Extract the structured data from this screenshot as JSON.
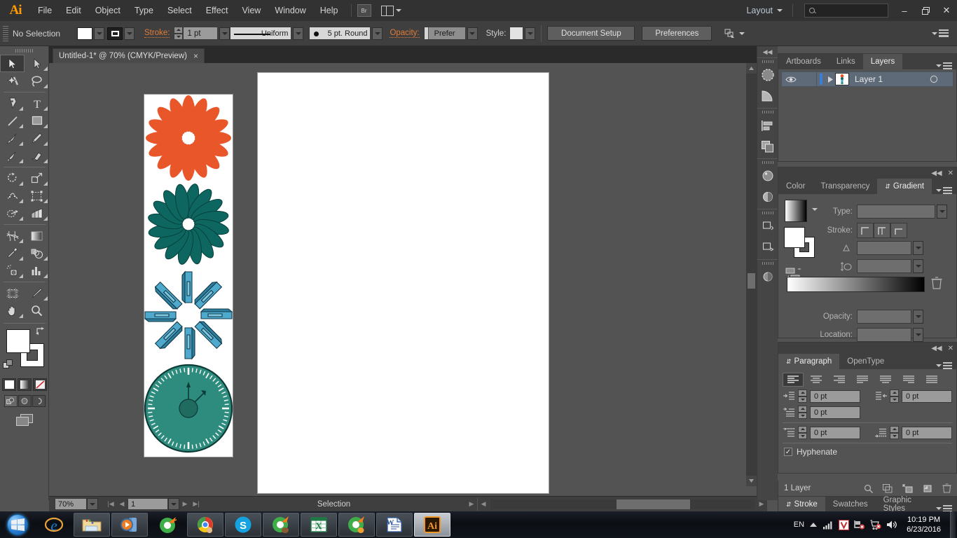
{
  "app": {
    "name": "Ai",
    "logo_text": "Ai"
  },
  "menubar": {
    "items": [
      "File",
      "Edit",
      "Object",
      "Type",
      "Select",
      "Effect",
      "View",
      "Window",
      "Help"
    ],
    "bridge_label": "Br",
    "layout_label": "Layout",
    "search_placeholder": "",
    "window_buttons": {
      "minimize": "–",
      "restore": "❐",
      "close": "✕"
    }
  },
  "optionbar": {
    "selection_status": "No Selection",
    "stroke_label": "Stroke:",
    "stroke_weight": "1 pt",
    "profile_label": "Uniform",
    "brush_label": "5 pt. Round",
    "opacity_label": "Opacity:",
    "opacity_value": "Prefer",
    "style_label": "Style:",
    "document_setup_label": "Document Setup",
    "preferences_label": "Preferences"
  },
  "toolbar": {
    "tools": [
      "selection-tool",
      "direct-selection-tool",
      "magic-wand-tool",
      "lasso-tool",
      "pen-tool",
      "type-tool",
      "line-segment-tool",
      "rectangle-tool",
      "paintbrush-tool",
      "pencil-tool",
      "blob-brush-tool",
      "eraser-tool",
      "rotate-tool",
      "scale-tool",
      "width-tool",
      "free-transform-tool",
      "shape-builder-tool",
      "perspective-grid-tool",
      "mesh-tool",
      "gradient-tool",
      "eyedropper-tool",
      "blend-tool",
      "symbol-sprayer-tool",
      "column-graph-tool",
      "artboard-tool",
      "slice-tool",
      "hand-tool",
      "zoom-tool"
    ],
    "selected_tool": "selection-tool",
    "fill_color": "#FFFFFF",
    "stroke_color": "#000000",
    "color_modes": [
      "color-mode",
      "gradient-mode",
      "none-mode"
    ],
    "draw_modes": [
      "draw-normal",
      "draw-behind",
      "draw-inside"
    ],
    "screen_mode": "change-screen-mode"
  },
  "document": {
    "tab_title": "Untitled-1* @ 70% (CMYK/Preview)",
    "close_label": "×"
  },
  "statusbar": {
    "zoom_level": "70%",
    "artboard_number": "1",
    "status_text": "Selection"
  },
  "artwork": {
    "orange_color": "#E8562A",
    "teal_color": "#0D6660",
    "blue_color": "#3B9FC4",
    "clock_color": "#2E8C7E",
    "objects": [
      "orange-flower",
      "teal-flower",
      "blue-pinwheel",
      "teal-clock"
    ]
  },
  "layers_panel": {
    "tabs": [
      "Artboards",
      "Links",
      "Layers"
    ],
    "active_tab": "Layers",
    "rows": [
      {
        "name": "Layer 1",
        "visible": true,
        "locked": false,
        "selected": true
      }
    ],
    "footer_text": "1 Layer",
    "footer_icons": [
      "locate-object-icon",
      "make-clipping-mask-icon",
      "create-sublayer-icon",
      "create-new-layer-icon",
      "delete-selection-icon"
    ]
  },
  "gradient_panel": {
    "tabs": [
      "Color",
      "Transparency",
      "Gradient"
    ],
    "active_tab": "Gradient",
    "type_label": "Type:",
    "type_value": "",
    "stroke_label": "Stroke:",
    "angle_value": "",
    "aspect_value": "",
    "opacity_label": "Opacity:",
    "opacity_value": "",
    "location_label": "Location:",
    "location_value": "",
    "gradient_start": "#FFFFFF",
    "gradient_end": "#000000"
  },
  "paragraph_panel": {
    "tabs": [
      "Paragraph",
      "OpenType"
    ],
    "active_tab": "Paragraph",
    "align_buttons": [
      "align-left",
      "align-center",
      "align-right",
      "justify-last-left",
      "justify-last-center",
      "justify-last-right",
      "justify-all"
    ],
    "selected_align": "align-left",
    "left_indent": "0 pt",
    "right_indent": "0 pt",
    "first_line_indent": "0 pt",
    "space_before": "0 pt",
    "space_after": "0 pt",
    "hyphenate_label": "Hyphenate",
    "hyphenate_checked": true
  },
  "bottom_dock": {
    "tabs": [
      "Stroke",
      "Swatches",
      "Graphic Styles"
    ],
    "active_tab": "Stroke"
  },
  "taskbar": {
    "start_label": "start",
    "items": [
      "internet-explorer",
      "file-explorer",
      "media-player",
      "download-manager",
      "google-chrome",
      "skype",
      "download-manager-2",
      "excel",
      "download-manager-3",
      "word",
      "illustrator"
    ],
    "active_item": "illustrator",
    "tray": {
      "language": "EN",
      "icons": [
        "show-hidden-icons",
        "network-signal-icon",
        "antivirus-icon",
        "network-error-icon",
        "action-center-icon",
        "volume-icon"
      ],
      "time": "10:19 PM",
      "date": "6/23/2016"
    }
  }
}
